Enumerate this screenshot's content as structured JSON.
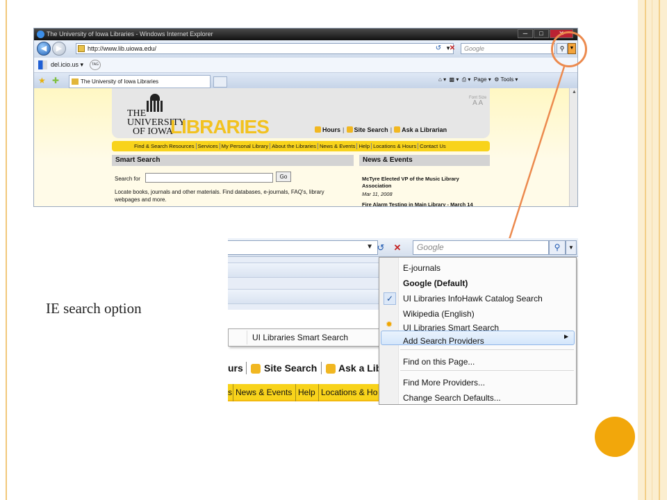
{
  "slide": {
    "caption": "IE search option",
    "accent_color": "#f2a70b",
    "arrow_color": "#ec8a4e"
  },
  "screenshot1": {
    "window_title": "The University of Iowa Libraries - Windows Internet Explorer",
    "address_url": "http://www.lib.uiowa.edu/",
    "search_placeholder": "Google",
    "favorites_bar": {
      "delicious_label": "del.icio.us",
      "tag_label": "TAG"
    },
    "tab_title": "The University of Iowa Libraries",
    "command_bar": {
      "page_label": "Page",
      "tools_label": "Tools"
    },
    "site": {
      "logo_the": "THE",
      "logo_university": "UNIVERSITY",
      "logo_of_iowa": "OF IOWA",
      "logo_libraries": "LIBRARIES",
      "font_size_label": "Font Size",
      "font_size_glyphs": "A A",
      "top_links": [
        "Hours",
        "Site Search",
        "Ask a Librarian"
      ],
      "nav_links": [
        "Find & Search Resources",
        "Services",
        "My Personal Library",
        "About the Libraries",
        "News & Events",
        "Help",
        "Locations & Hours",
        "Contact Us"
      ],
      "smart_search_title": "Smart Search",
      "search_for_label": "Search for",
      "go_label": "Go",
      "locate_text": "Locate books, journals and other materials. Find databases, e-journals, FAQ's, library webpages and more.",
      "news_title": "News & Events",
      "news_items": [
        {
          "headline": "McTyre Elected VP of the Music Library Association",
          "date": "Mar 11, 2008"
        },
        {
          "headline": "Fire Alarm Testing in Main Library - March 14",
          "date": ""
        }
      ]
    }
  },
  "screenshot2": {
    "search_placeholder": "Google",
    "menu_items": [
      {
        "label": "E-journals",
        "checked": false,
        "bold": false
      },
      {
        "label": "Google (Default)",
        "checked": true,
        "bold": true
      },
      {
        "label": "UI Libraries InfoHawk Catalog Search",
        "checked": false,
        "bold": false
      },
      {
        "label": "Wikipedia (English)",
        "checked": false,
        "bold": false
      },
      {
        "label": "UI Libraries Smart Search",
        "checked": false,
        "bold": false
      },
      {
        "label": "Add Search Providers",
        "checked": false,
        "bold": false,
        "has_submenu": true
      },
      {
        "label": "Find on this Page...",
        "checked": false,
        "bold": false
      },
      {
        "label": "Find More Providers...",
        "checked": false,
        "bold": false
      },
      {
        "label": "Change Search Defaults...",
        "checked": false,
        "bold": false
      }
    ],
    "submenu_item": "UI Libraries Smart Search",
    "partial_top_links": [
      "urs",
      "Site Search",
      "Ask a Lib"
    ],
    "partial_nav_links": [
      "s",
      "News & Events",
      "Help",
      "Locations & Ho"
    ]
  }
}
